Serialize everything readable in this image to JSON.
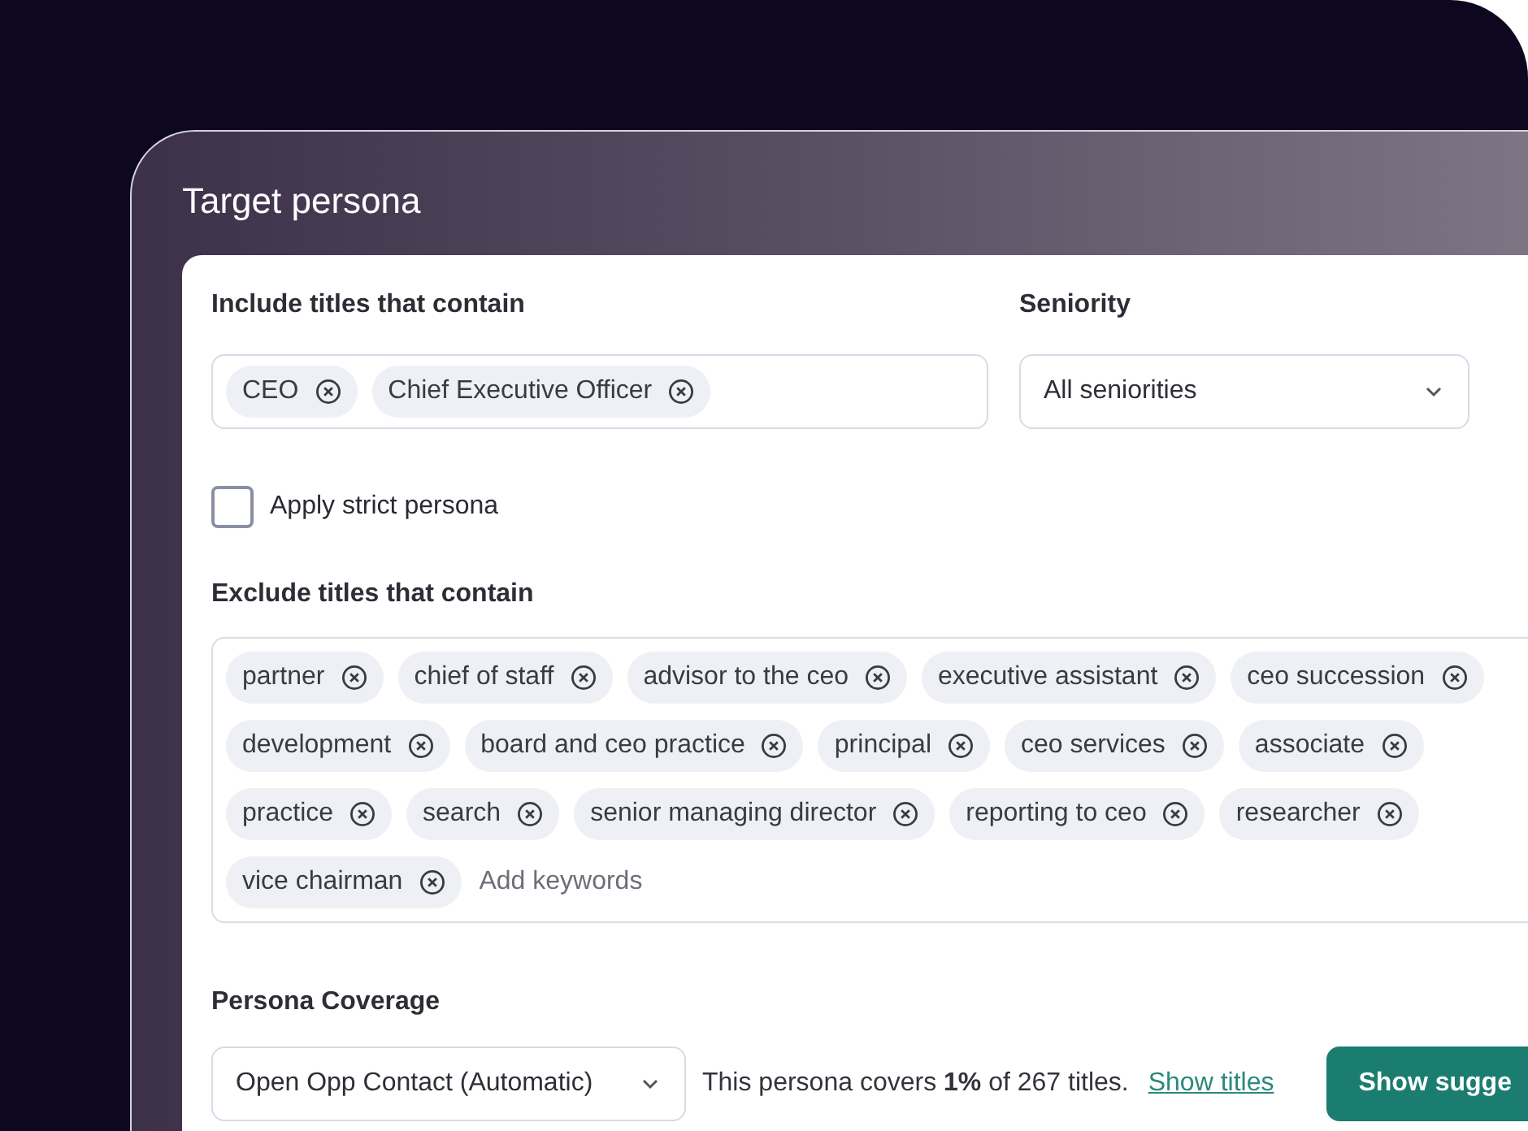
{
  "panel": {
    "title": "Target persona"
  },
  "include": {
    "label": "Include titles that contain",
    "tags": [
      "CEO",
      "Chief Executive Officer"
    ]
  },
  "seniority": {
    "label": "Seniority",
    "value": "All seniorities"
  },
  "strict_persona": {
    "label": "Apply strict persona",
    "checked": false
  },
  "exclude": {
    "label": "Exclude titles that contain",
    "tags": [
      "partner",
      "chief of staff",
      "advisor to the ceo",
      "executive assistant",
      "ceo succession",
      "development",
      "board and ceo practice",
      "principal",
      "ceo services",
      "associate",
      "practice",
      "search",
      "senior managing director",
      "reporting to ceo",
      "researcher",
      "vice chairman"
    ],
    "placeholder": "Add keywords"
  },
  "coverage": {
    "label": "Persona Coverage",
    "value": "Open Opp Contact (Automatic)",
    "summary": "This persona covers **1%** of 267 titles.",
    "link": "Show titles",
    "button": "Show sugge"
  }
}
